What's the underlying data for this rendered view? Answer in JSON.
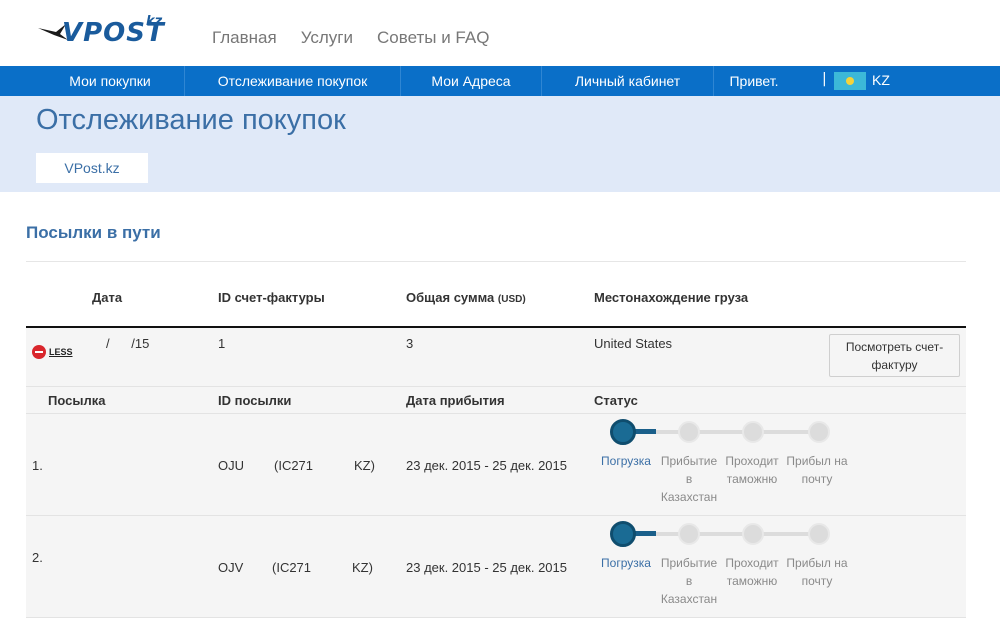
{
  "header": {
    "logo_text": "VPOST",
    "logo_suffix": "kz",
    "nav": [
      "Главная",
      "Услуги",
      "Советы и FAQ"
    ]
  },
  "navbar": {
    "items": [
      "Мои покупки",
      "Отслеживание покупок",
      "Мои Адреса",
      "Личный кабинет",
      "Привет."
    ],
    "separator": "|",
    "country_code": "KZ",
    "flag_color": "#3cb8d8",
    "bar_color": "#0a6fc8"
  },
  "banner": {
    "title": "Отслеживание покупок",
    "breadcrumb": "VPost.kz"
  },
  "section": {
    "title": "Посылки в пути"
  },
  "table": {
    "headers": {
      "date": "Дата",
      "invoice_id": "ID счет-фактуры",
      "total": "Общая сумма",
      "total_unit": "(USD)",
      "location": "Местонахождение груза"
    },
    "invoice": {
      "less_label": "LESS",
      "date": "/      /15",
      "invoice_id": "1",
      "total": "3",
      "location": "United States",
      "view_button": "Посмотреть счет-фактуру"
    },
    "sub_headers": {
      "parcel": "Посылка",
      "parcel_id": "ID посылки",
      "arrival": "Дата прибытия",
      "status": "Статус"
    },
    "parcels": [
      {
        "num": "1.",
        "id_a": "OJU",
        "id_b": "(IC271",
        "id_c": "KZ)",
        "arrival": "23 дек. 2015 - 25 дек. 2015"
      },
      {
        "num": "2.",
        "id_a": "OJV",
        "id_b": "(IC271",
        "id_c": "KZ)",
        "arrival": "23 дек. 2015 - 25 дек. 2015"
      }
    ],
    "status_steps": [
      "Погрузка",
      "Прибытие в Казахстан",
      "Проходит таможню",
      "Прибыл на почту"
    ]
  }
}
